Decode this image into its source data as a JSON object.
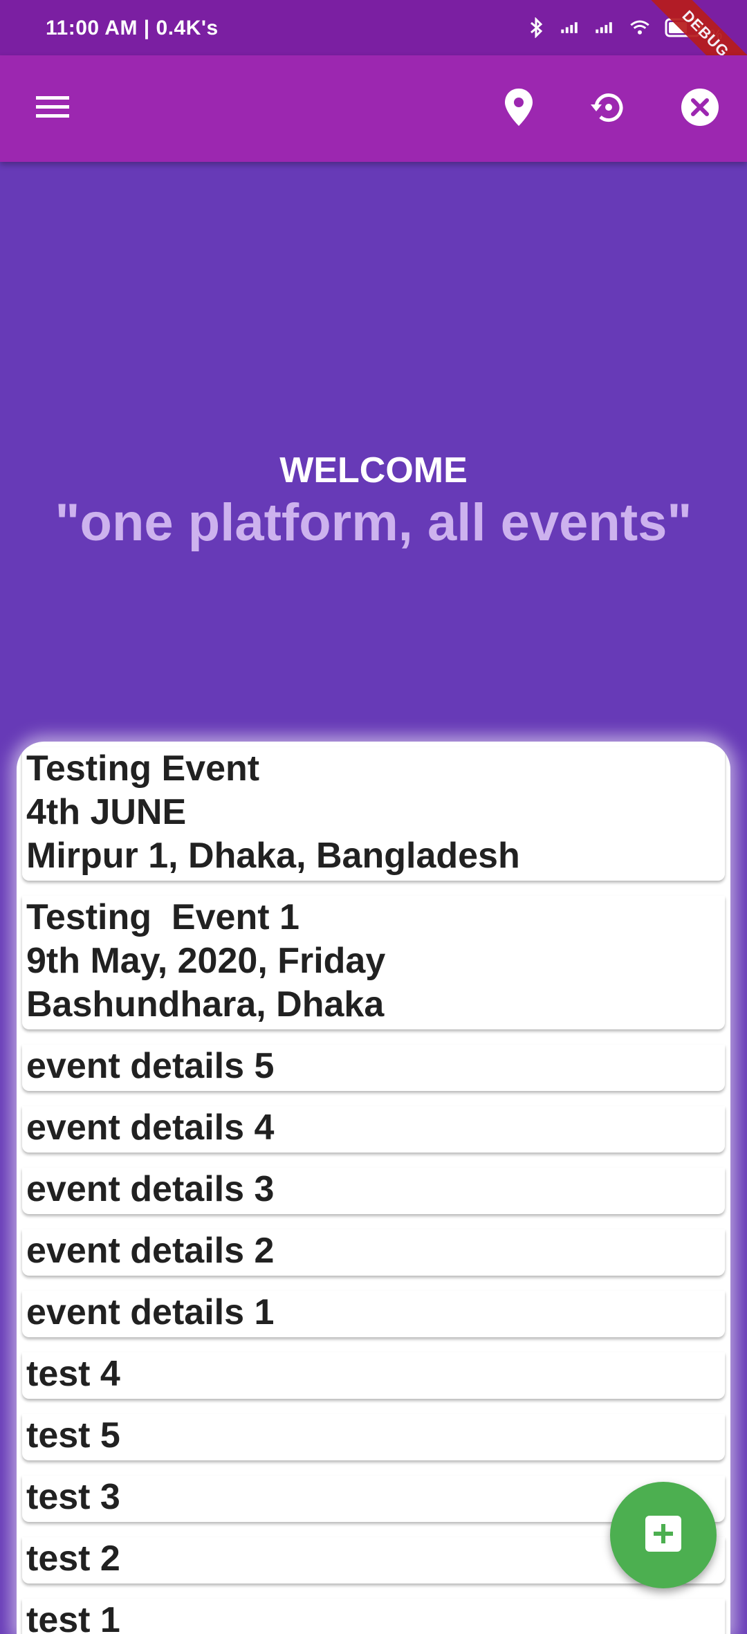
{
  "status_bar": {
    "time": "11:00 AM | 0.4K's",
    "battery_text": "%"
  },
  "debug_banner": "DEBUG",
  "app_bar": {
    "menu_icon": "menu-icon",
    "location_icon": "location-pin-icon",
    "history_icon": "history-icon",
    "close_icon": "close-circle-icon"
  },
  "hero": {
    "welcome": "WELCOME",
    "tagline": "\"one platform, all events\""
  },
  "events": [
    {
      "lines": [
        "Testing Event",
        "4th JUNE",
        "Mirpur 1, Dhaka, Bangladesh"
      ]
    },
    {
      "lines": [
        "Testing  Event 1",
        "9th May, 2020, Friday",
        "Bashundhara, Dhaka"
      ]
    },
    {
      "lines": [
        "event details 5"
      ]
    },
    {
      "lines": [
        "event details 4"
      ]
    },
    {
      "lines": [
        "event details 3"
      ]
    },
    {
      "lines": [
        "event details 2"
      ]
    },
    {
      "lines": [
        "event details 1"
      ]
    },
    {
      "lines": [
        "test 4"
      ]
    },
    {
      "lines": [
        "test 5"
      ]
    },
    {
      "lines": [
        "test 3"
      ]
    },
    {
      "lines": [
        "test 2"
      ]
    },
    {
      "lines": [
        "test 1"
      ]
    }
  ],
  "fab": {
    "icon": "add-box-icon"
  },
  "colors": {
    "status_bar": "#7B1FA2",
    "app_bar": "#9C27B0",
    "background": "#673AB7",
    "tagline": "#CDB2EE",
    "fab": "#4CAF50"
  }
}
